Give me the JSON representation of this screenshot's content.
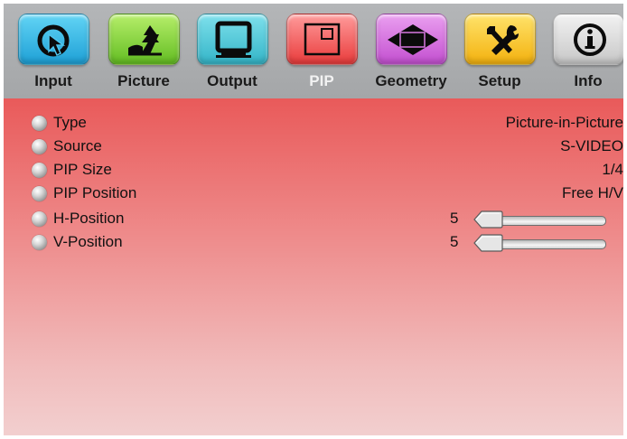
{
  "tabs": [
    {
      "id": "input",
      "label": "Input",
      "icon": "cursor-arrow-icon",
      "color": "#1ea0d6"
    },
    {
      "id": "picture",
      "label": "Picture",
      "icon": "landscape-tree-icon",
      "color": "#63bd22"
    },
    {
      "id": "output",
      "label": "Output",
      "icon": "monitor-icon",
      "color": "#34b5c8"
    },
    {
      "id": "pip",
      "label": "PIP",
      "icon": "pip-window-icon",
      "color": "#e93b3b",
      "active": true
    },
    {
      "id": "geometry",
      "label": "Geometry",
      "icon": "geometry-diamond-icon",
      "color": "#c34fd0"
    },
    {
      "id": "setup",
      "label": "Setup",
      "icon": "tools-icon",
      "color": "#f3b10e"
    },
    {
      "id": "info",
      "label": "Info",
      "icon": "info-icon",
      "color": "#c7c7c7"
    }
  ],
  "menu": {
    "items": [
      {
        "label": "Type",
        "value": "Picture-in-Picture"
      },
      {
        "label": "Source",
        "value": "S-VIDEO"
      },
      {
        "label": "PIP Size",
        "value": "1/4"
      },
      {
        "label": "PIP Position",
        "value": "Free H/V"
      },
      {
        "label": "H-Position",
        "value": "5",
        "slider_min": 0,
        "slider_max": 100,
        "slider_value": 5
      },
      {
        "label": "V-Position",
        "value": "5",
        "slider_min": 0,
        "slider_max": 100,
        "slider_value": 5
      }
    ]
  },
  "colors": {
    "panel_top": "#e95a5a",
    "panel_bottom": "#f2cfcf",
    "tabbar": "#a4a6a8",
    "active_label": "#f2f2f2"
  }
}
